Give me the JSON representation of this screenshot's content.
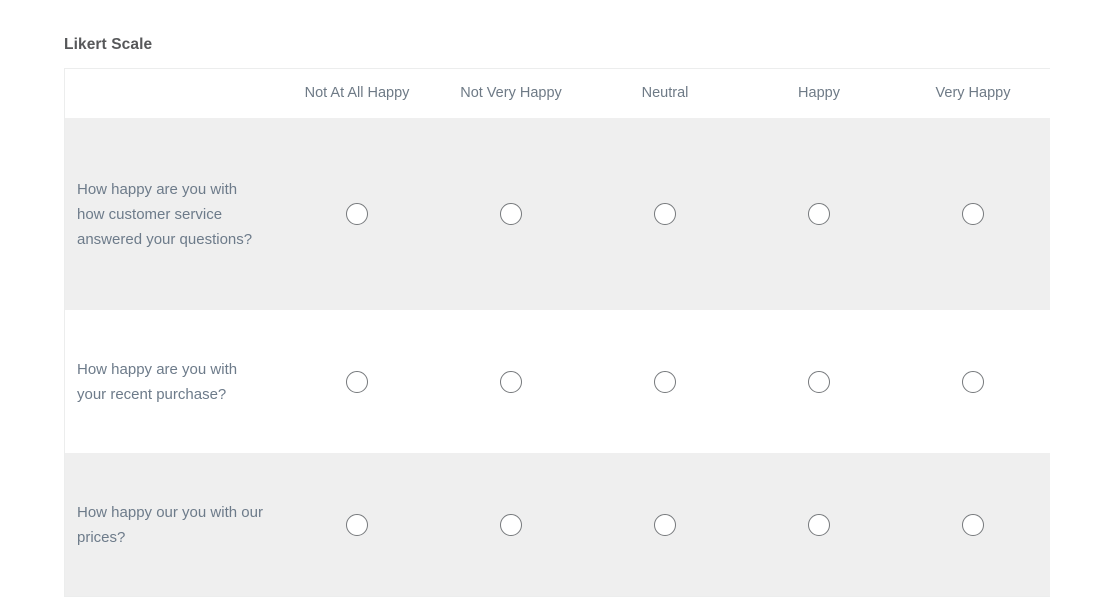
{
  "widget": {
    "title": "Likert Scale",
    "type": "likert-matrix"
  },
  "table": {
    "question_column_header": "",
    "columns": [
      {
        "label": "Not At All Happy",
        "value": 1
      },
      {
        "label": "Not Very Happy",
        "value": 2
      },
      {
        "label": "Neutral",
        "value": 3
      },
      {
        "label": "Happy",
        "value": 4
      },
      {
        "label": "Very Happy",
        "value": 5
      }
    ],
    "rows": [
      {
        "question": "How happy are you with how customer service answered your questions?",
        "selected": null,
        "shaded": true
      },
      {
        "question": "How happy are you with your recent purchase?",
        "selected": null,
        "shaded": false
      },
      {
        "question": "How happy our you with our prices?",
        "selected": null,
        "shaded": true
      }
    ]
  },
  "colors": {
    "title_text": "#57585a",
    "header_text": "#6e7a86",
    "question_text": "#6d7b8a",
    "row_shaded_bg": "#efefef",
    "row_plain_bg": "#ffffff",
    "table_border": "#eceded",
    "radio_border": "#76797c",
    "page_bg": "#ffffff"
  }
}
